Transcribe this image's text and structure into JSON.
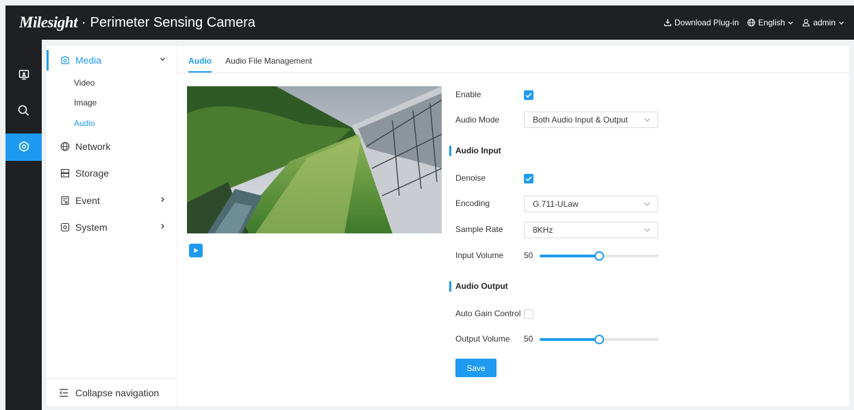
{
  "header": {
    "logo": "Milesight",
    "separator": "·",
    "title": "Perimeter Sensing Camera",
    "download_label": "Download Plug-in",
    "language": "English",
    "user": "admin"
  },
  "iconbar": {
    "items": [
      {
        "icon": "live-view-icon"
      },
      {
        "icon": "search-icon"
      },
      {
        "icon": "settings-icon",
        "active": true
      }
    ]
  },
  "sidebar": {
    "media": {
      "label": "Media",
      "icon": "media-icon"
    },
    "media_sub": [
      {
        "label": "Video"
      },
      {
        "label": "Image"
      },
      {
        "label": "Audio",
        "active": true
      }
    ],
    "network": {
      "label": "Network",
      "icon": "globe-icon"
    },
    "storage": {
      "label": "Storage",
      "icon": "storage-icon"
    },
    "event": {
      "label": "Event",
      "icon": "event-icon"
    },
    "system": {
      "label": "System",
      "icon": "system-icon"
    },
    "collapse_label": "Collapse navigation"
  },
  "tabs": [
    {
      "label": "Audio",
      "active": true
    },
    {
      "label": "Audio File Management"
    }
  ],
  "form": {
    "enable": {
      "label": "Enable",
      "checked": true
    },
    "audio_mode": {
      "label": "Audio Mode",
      "value": "Both Audio Input & Output"
    },
    "audio_input_title": "Audio Input",
    "denoise": {
      "label": "Denoise",
      "checked": true
    },
    "encoding": {
      "label": "Encoding",
      "value": "G.711-ULaw"
    },
    "sample_rate": {
      "label": "Sample Rate",
      "value": "8KHz"
    },
    "input_volume": {
      "label": "Input Volume",
      "value": "50",
      "level": 50
    },
    "audio_output_title": "Audio Output",
    "auto_gain": {
      "label": "Auto Gain Control",
      "checked": false
    },
    "output_volume": {
      "label": "Output Volume",
      "value": "50",
      "level": 50
    },
    "save_label": "Save"
  },
  "colors": {
    "accent": "#1e9bf0",
    "header_bg": "#1f2023"
  }
}
